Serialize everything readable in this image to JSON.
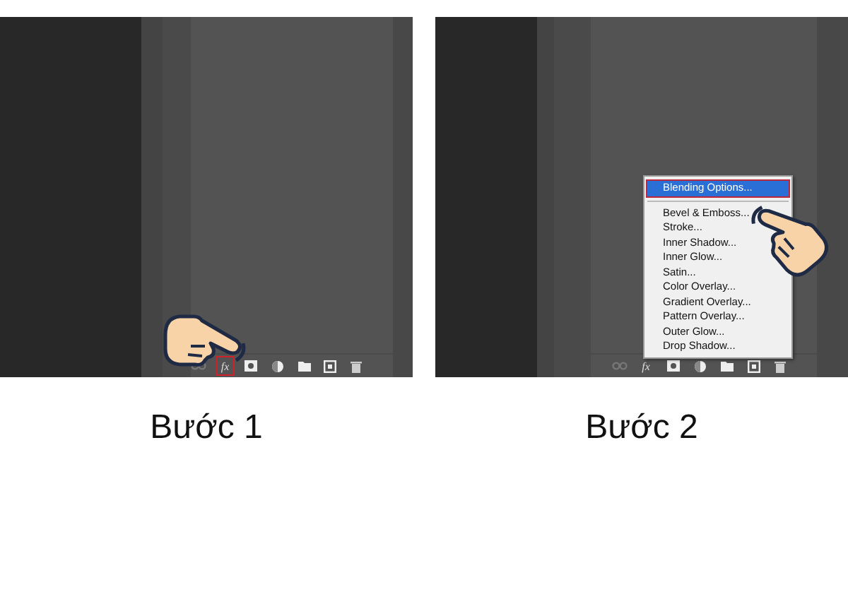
{
  "steps": [
    {
      "caption": "Bước 1",
      "hand_pointer": true,
      "toolbar": [
        {
          "kind": "link",
          "highlighted": false
        },
        {
          "kind": "fx",
          "label": "fx",
          "highlighted": true
        },
        {
          "kind": "mask",
          "highlighted": false
        },
        {
          "kind": "adjustment",
          "highlighted": false
        },
        {
          "kind": "folder",
          "highlighted": false
        },
        {
          "kind": "new",
          "highlighted": false
        },
        {
          "kind": "trash",
          "highlighted": false
        }
      ]
    },
    {
      "caption": "Bước 2",
      "hand_pointer": true,
      "toolbar": [
        {
          "kind": "link",
          "highlighted": false
        },
        {
          "kind": "fx",
          "label": "fx",
          "highlighted": false
        },
        {
          "kind": "mask",
          "highlighted": false
        },
        {
          "kind": "adjustment",
          "highlighted": false
        },
        {
          "kind": "folder",
          "highlighted": false
        },
        {
          "kind": "new",
          "highlighted": false
        },
        {
          "kind": "trash",
          "highlighted": false
        }
      ],
      "menu": {
        "sections": [
          [
            {
              "label": "Blending Options...",
              "selected": true
            }
          ],
          [
            {
              "label": "Bevel & Emboss...",
              "selected": false
            },
            {
              "label": "Stroke...",
              "selected": false
            },
            {
              "label": "Inner Shadow...",
              "selected": false
            },
            {
              "label": "Inner Glow...",
              "selected": false
            },
            {
              "label": "Satin...",
              "selected": false
            },
            {
              "label": "Color Overlay...",
              "selected": false
            },
            {
              "label": "Gradient Overlay...",
              "selected": false
            },
            {
              "label": "Pattern Overlay...",
              "selected": false
            },
            {
              "label": "Outer Glow...",
              "selected": false
            },
            {
              "label": "Drop Shadow...",
              "selected": false
            }
          ]
        ]
      }
    }
  ]
}
